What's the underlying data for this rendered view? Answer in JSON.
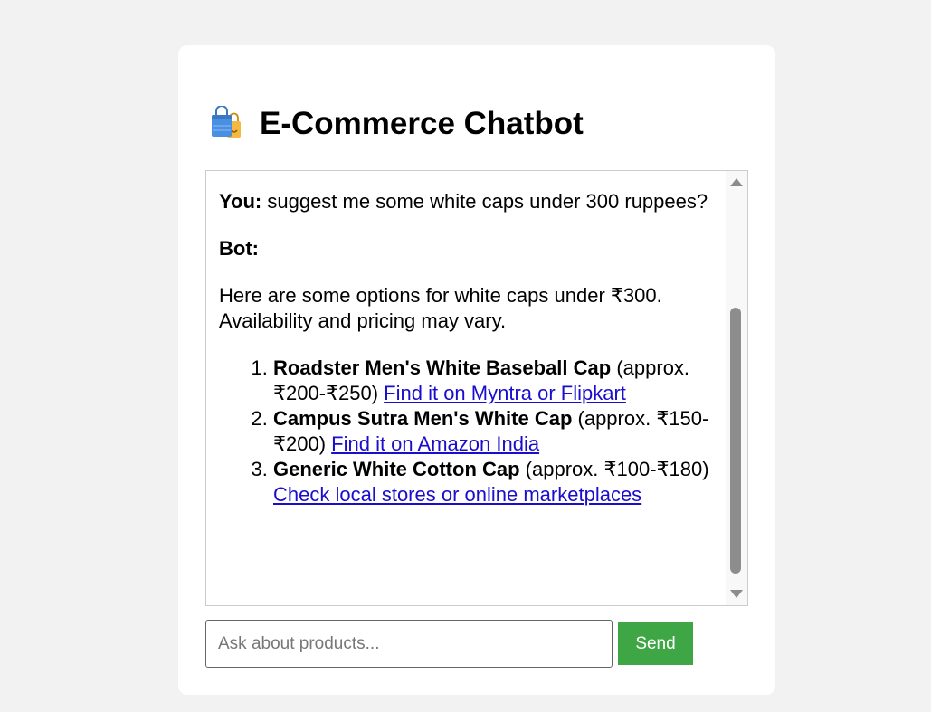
{
  "header": {
    "title": "E-Commerce Chatbot",
    "icon": "shopping-bags-icon"
  },
  "chat": {
    "messages": [
      {
        "sender_label": "You:",
        "text": " suggest me some white caps under 300 ruppees?"
      },
      {
        "sender_label": "Bot:",
        "text": "Here are some options for white caps under ₹300. Availability and pricing may vary."
      }
    ],
    "options": [
      {
        "name": "Roadster Men's White Baseball Cap",
        "detail": " (approx. ₹200-₹250) ",
        "link": "Find it on Myntra or Flipkart"
      },
      {
        "name": "Campus Sutra Men's White Cap",
        "detail": " (approx. ₹150-₹200) ",
        "link": "Find it on Amazon India"
      },
      {
        "name": "Generic White Cotton Cap",
        "detail": " (approx. ₹100-₹180) ",
        "link": "Check local stores or online marketplaces"
      }
    ]
  },
  "input": {
    "placeholder": "Ask about products...",
    "value": ""
  },
  "send": {
    "label": "Send"
  },
  "colors": {
    "page_background": "#f2f2f2",
    "card_background": "#ffffff",
    "send_button": "#3fa646",
    "link": "#1a0dcc"
  }
}
